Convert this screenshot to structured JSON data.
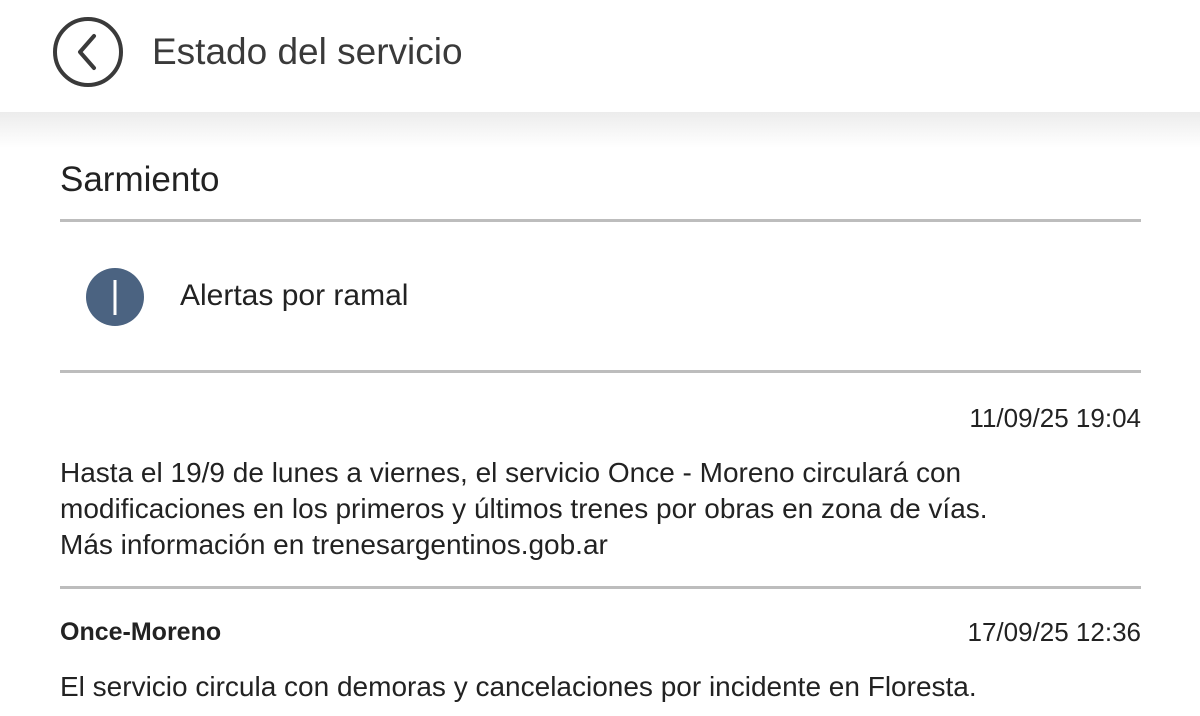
{
  "header": {
    "title": "Estado del servicio",
    "back_icon": "chevron-left-icon"
  },
  "line": {
    "name": "Sarmiento"
  },
  "alerts_link": {
    "icon": "info-icon",
    "icon_color": "#4b6381",
    "label": "Alertas por ramal"
  },
  "alerts": [
    {
      "branch": "",
      "timestamp": "11/09/25 19:04",
      "text": "Hasta el 19/9 de lunes a viernes, el servicio Once - Moreno circulará con modificaciones en los primeros y últimos trenes por obras en zona de vías. Más información en trenesargentinos.gob.ar"
    },
    {
      "branch": "Once-Moreno",
      "timestamp": "17/09/25 12:36",
      "text": "El servicio circula con demoras y cancelaciones por incidente en Floresta."
    }
  ]
}
